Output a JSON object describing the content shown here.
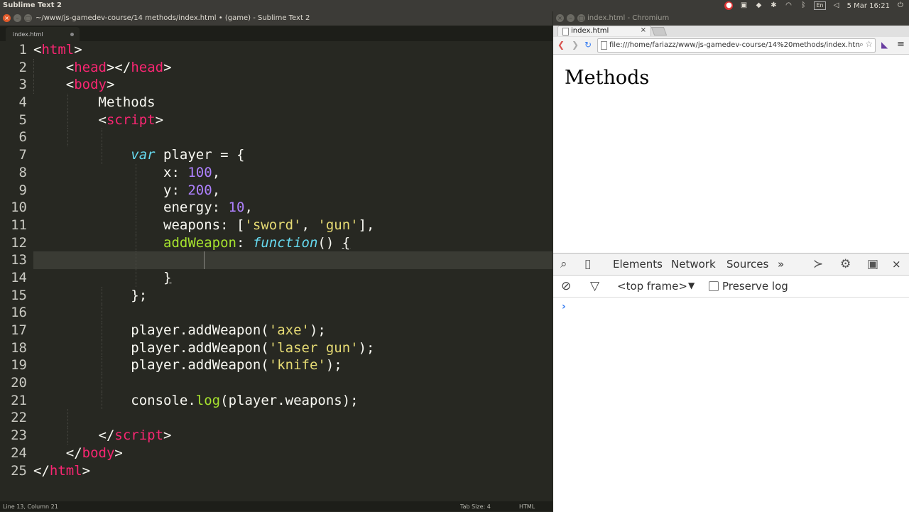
{
  "system_bar": {
    "app_title": "Sublime Text 2",
    "language": "En",
    "clock": "5 Mar 16:21"
  },
  "sublime": {
    "window_title": "~/www/js-gamedev-course/14 methods/index.html • (game) - Sublime Text 2",
    "tab_label": "index.html",
    "line_numbers": [
      "1",
      "2",
      "3",
      "4",
      "5",
      "6",
      "7",
      "8",
      "9",
      "10",
      "11",
      "12",
      "13",
      "14",
      "15",
      "16",
      "17",
      "18",
      "19",
      "20",
      "21",
      "22",
      "23",
      "24",
      "25"
    ],
    "code": {
      "l1_lt": "<",
      "l1_tag": "html",
      "l1_gt": ">",
      "l2_lt": "<",
      "l2_tag": "head",
      "l2_mid": "></",
      "l2_tag2": "head",
      "l2_gt": ">",
      "l3_lt": "<",
      "l3_tag": "body",
      "l3_gt": ">",
      "l4_text": "Methods",
      "l5_lt": "<",
      "l5_tag": "script",
      "l5_gt": ">",
      "l7_kw": "var",
      "l7_rest": " player = {",
      "l8_key": "x: ",
      "l8_num": "100",
      "l8_end": ",",
      "l9_key": "y: ",
      "l9_num": "200",
      "l9_end": ",",
      "l10_key": "energy: ",
      "l10_num": "10",
      "l10_end": ",",
      "l11_key": "weapons: [",
      "l11_s1": "'sword'",
      "l11_sep": ", ",
      "l11_s2": "'gun'",
      "l11_end": "],",
      "l12_fn": "addWeapon",
      "l12_colon": ": ",
      "l12_kw": "function",
      "l12_paren": "() ",
      "l12_brace": "{",
      "l14_brace": "}",
      "l15_end": "};",
      "l17_a": "player.addWeapon(",
      "l17_s": "'axe'",
      "l17_b": ");",
      "l18_a": "player.addWeapon(",
      "l18_s": "'laser gun'",
      "l18_b": ");",
      "l19_a": "player.addWeapon(",
      "l19_s": "'knife'",
      "l19_b": ");",
      "l21_a": "console.",
      "l21_fn": "log",
      "l21_b": "(player.weapons);",
      "l23_lt": "</",
      "l23_tag": "script",
      "l23_gt": ">",
      "l24_lt": "</",
      "l24_tag": "body",
      "l24_gt": ">",
      "l25_lt": "</",
      "l25_tag": "html",
      "l25_gt": ">"
    },
    "status": {
      "position": "Line 13, Column 21",
      "tab_size": "Tab Size: 4",
      "syntax": "HTML"
    }
  },
  "chromium": {
    "window_title": "index.html - Chromium",
    "tab_label": "index.html",
    "tab_close": "×",
    "url": "file:///home/fariazz/www/js-gamedev-course/14%20methods/index.html",
    "page_heading": "Methods",
    "devtools": {
      "tabs": [
        "Elements",
        "Network",
        "Sources"
      ],
      "more": "»",
      "close": "×",
      "frame_select": "<top frame>",
      "frame_arrow": "▼",
      "preserve_log": "Preserve log",
      "prompt": "›"
    }
  },
  "colors": {
    "editor_bg": "#272822",
    "tag": "#f92672",
    "string": "#e6db74",
    "number": "#ae81ff",
    "function": "#a6e22e",
    "keyword": "#66d9ef"
  }
}
